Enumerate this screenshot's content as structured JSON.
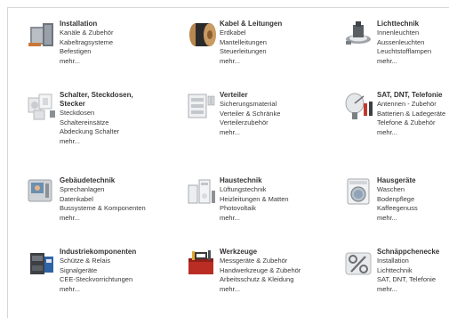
{
  "categories": [
    {
      "title": "Installation",
      "icon": "installation-box-icon",
      "links": [
        "Kanäle & Zubehör",
        "Kabeltragsysteme",
        "Befestigen"
      ],
      "more": "mehr..."
    },
    {
      "title": "Kabel & Leitungen",
      "icon": "cable-drum-icon",
      "links": [
        "Erdkabel",
        "Mantelleitungen",
        "Steuerleitungen"
      ],
      "more": "mehr..."
    },
    {
      "title": "Lichttechnik",
      "icon": "recessed-light-icon",
      "links": [
        "Innenleuchten",
        "Aussenleuchten",
        "Leuchtstofflampen"
      ],
      "more": "mehr..."
    },
    {
      "title": "Schalter, Steckdosen, Stecker",
      "icon": "switch-socket-icon",
      "links": [
        "Steckdosen",
        "Schaltereinsätze",
        "Abdeckung Schalter"
      ],
      "more": "mehr..."
    },
    {
      "title": "Verteiler",
      "icon": "distribution-board-icon",
      "links": [
        "Sicherungsmaterial",
        "Verteiler & Schränke",
        "Verteilerzubehör"
      ],
      "more": "mehr..."
    },
    {
      "title": "SAT, DNT, Telefonie",
      "icon": "satellite-dish-icon",
      "links": [
        "Antennen - Zubehör",
        "Batterien & Ladegeräte",
        "Telefone & Zubehör"
      ],
      "more": "mehr..."
    },
    {
      "title": "Gebäudetechnik",
      "icon": "intercom-icon",
      "links": [
        "Sprechanlagen",
        "Datenkabel",
        "Bussysteme & Komponenten"
      ],
      "more": "mehr..."
    },
    {
      "title": "Haustechnik",
      "icon": "heater-icon",
      "links": [
        "Lüftungstechnik",
        "Heizleitungen & Matten",
        "Photovoltaik"
      ],
      "more": "mehr..."
    },
    {
      "title": "Hausgeräte",
      "icon": "washing-machine-icon",
      "links": [
        "Waschen",
        "Bodenpflege",
        "Kaffeegenuss"
      ],
      "more": "mehr..."
    },
    {
      "title": "Industriekomponenten",
      "icon": "contactor-icon",
      "links": [
        "Schütze & Relais",
        "Signalgeräte",
        "CEE-Steckvorrichtungen"
      ],
      "more": "mehr..."
    },
    {
      "title": "Werkzeuge",
      "icon": "toolbox-icon",
      "links": [
        "Messgeräte & Zubehör",
        "Handwerkzeuge & Zubehör",
        "Arbeitsschutz & Kleidung"
      ],
      "more": "mehr..."
    },
    {
      "title": "Schnäppchenecke",
      "icon": "percent-sale-icon",
      "links": [
        "Installation",
        "Lichttechnik",
        "SAT, DNT, Telefonie"
      ],
      "more": "mehr..."
    }
  ]
}
